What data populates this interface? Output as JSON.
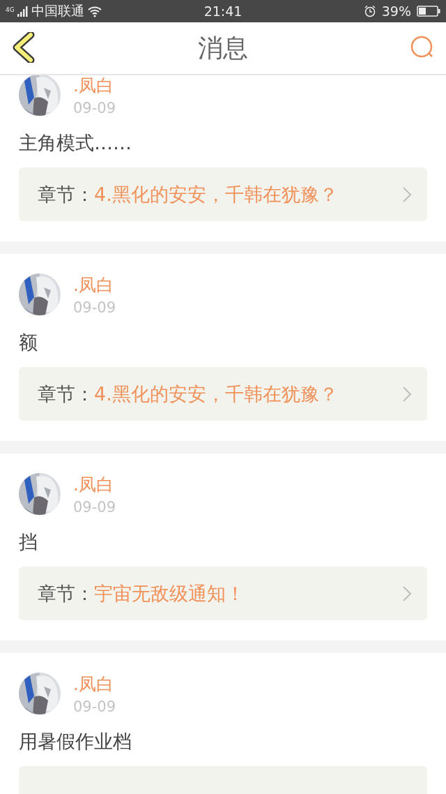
{
  "status_bar": {
    "network": "4G",
    "carrier": "中国联通",
    "time": "21:41",
    "battery": "39%"
  },
  "header": {
    "title": "消息"
  },
  "messages": [
    {
      "name": ".凤白",
      "date": "09-09",
      "text": "主角模式……",
      "chapter_label": "章节：",
      "chapter_title": "4.黑化的安安，千韩在犹豫？"
    },
    {
      "name": ".凤白",
      "date": "09-09",
      "text": "额",
      "chapter_label": "章节：",
      "chapter_title": "4.黑化的安安，千韩在犹豫？"
    },
    {
      "name": ".凤白",
      "date": "09-09",
      "text": "挡",
      "chapter_label": "章节：",
      "chapter_title": "宇宙无敌级通知！"
    },
    {
      "name": ".凤白",
      "date": "09-09",
      "text": "用暑假作业档"
    }
  ]
}
